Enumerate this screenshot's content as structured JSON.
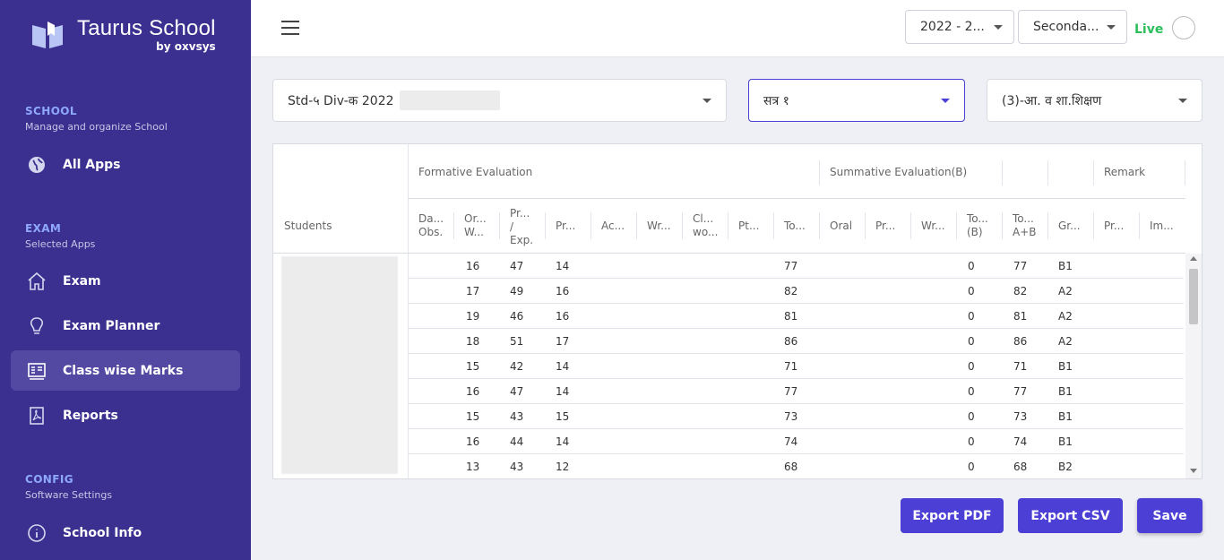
{
  "brand": {
    "name": "Taurus School",
    "by": "by oxvsys"
  },
  "sidebar": {
    "sections": [
      {
        "title": "SCHOOL",
        "subtitle": "Manage and organize School"
      },
      {
        "title": "EXAM",
        "subtitle": "Selected Apps"
      },
      {
        "title": "CONFIG",
        "subtitle": "Software Settings"
      }
    ],
    "items": [
      {
        "label": "All Apps",
        "icon": "globe-icon"
      },
      {
        "label": "Exam",
        "icon": "home-icon"
      },
      {
        "label": "Exam Planner",
        "icon": "lightbulb-icon"
      },
      {
        "label": "Class wise Marks",
        "icon": "marks-board-icon"
      },
      {
        "label": "Reports",
        "icon": "pdf-file-icon"
      },
      {
        "label": "School Info",
        "icon": "info-icon"
      }
    ]
  },
  "topbar": {
    "year_select": "2022 - 2...",
    "level_select": "Seconda...",
    "live_label": "Live"
  },
  "filters": {
    "class": "Std-५ Div-क 2022",
    "term": "सत्र १",
    "subject": "(3)-आ. व शा.शिक्षण"
  },
  "table": {
    "group_headers": [
      "Formative Evaluation",
      "Summative Evaluation(B)",
      "Remark"
    ],
    "students_header": "Students",
    "columns": [
      [
        "Da...",
        "Obs."
      ],
      [
        "Or...",
        "W..."
      ],
      [
        "Pr...",
        "/",
        "Exp."
      ],
      [
        "Pr..."
      ],
      [
        "Ac..."
      ],
      [
        "Wr..."
      ],
      [
        "Cl...",
        "wo..."
      ],
      [
        "Pt..."
      ],
      [
        "To..."
      ],
      [
        "Oral"
      ],
      [
        "Pr..."
      ],
      [
        "Wr..."
      ],
      [
        "To...",
        "(B)"
      ],
      [
        "To...",
        "A+B"
      ],
      [
        "Gr..."
      ],
      [
        "Pr..."
      ],
      [
        "Im..."
      ]
    ],
    "rows": [
      {
        "ow": "16",
        "pr_exp": "47",
        "pr": "14",
        "total_a": "77",
        "total_b": "0",
        "total_ab": "77",
        "grade": "B1"
      },
      {
        "ow": "17",
        "pr_exp": "49",
        "pr": "16",
        "total_a": "82",
        "total_b": "0",
        "total_ab": "82",
        "grade": "A2"
      },
      {
        "ow": "19",
        "pr_exp": "46",
        "pr": "16",
        "total_a": "81",
        "total_b": "0",
        "total_ab": "81",
        "grade": "A2"
      },
      {
        "ow": "18",
        "pr_exp": "51",
        "pr": "17",
        "total_a": "86",
        "total_b": "0",
        "total_ab": "86",
        "grade": "A2"
      },
      {
        "ow": "15",
        "pr_exp": "42",
        "pr": "14",
        "total_a": "71",
        "total_b": "0",
        "total_ab": "71",
        "grade": "B1"
      },
      {
        "ow": "16",
        "pr_exp": "47",
        "pr": "14",
        "total_a": "77",
        "total_b": "0",
        "total_ab": "77",
        "grade": "B1"
      },
      {
        "ow": "15",
        "pr_exp": "43",
        "pr": "15",
        "total_a": "73",
        "total_b": "0",
        "total_ab": "73",
        "grade": "B1"
      },
      {
        "ow": "16",
        "pr_exp": "44",
        "pr": "14",
        "total_a": "74",
        "total_b": "0",
        "total_ab": "74",
        "grade": "B1"
      },
      {
        "ow": "13",
        "pr_exp": "43",
        "pr": "12",
        "total_a": "68",
        "total_b": "0",
        "total_ab": "68",
        "grade": "B2"
      }
    ]
  },
  "buttons": {
    "export_pdf": "Export PDF",
    "export_csv": "Export CSV",
    "save": "Save"
  },
  "colors": {
    "sidebar_bg": "#3b2f8f",
    "accent": "#4b3fd6",
    "section_title": "#8fa8ff",
    "live": "#2bbf5b"
  }
}
